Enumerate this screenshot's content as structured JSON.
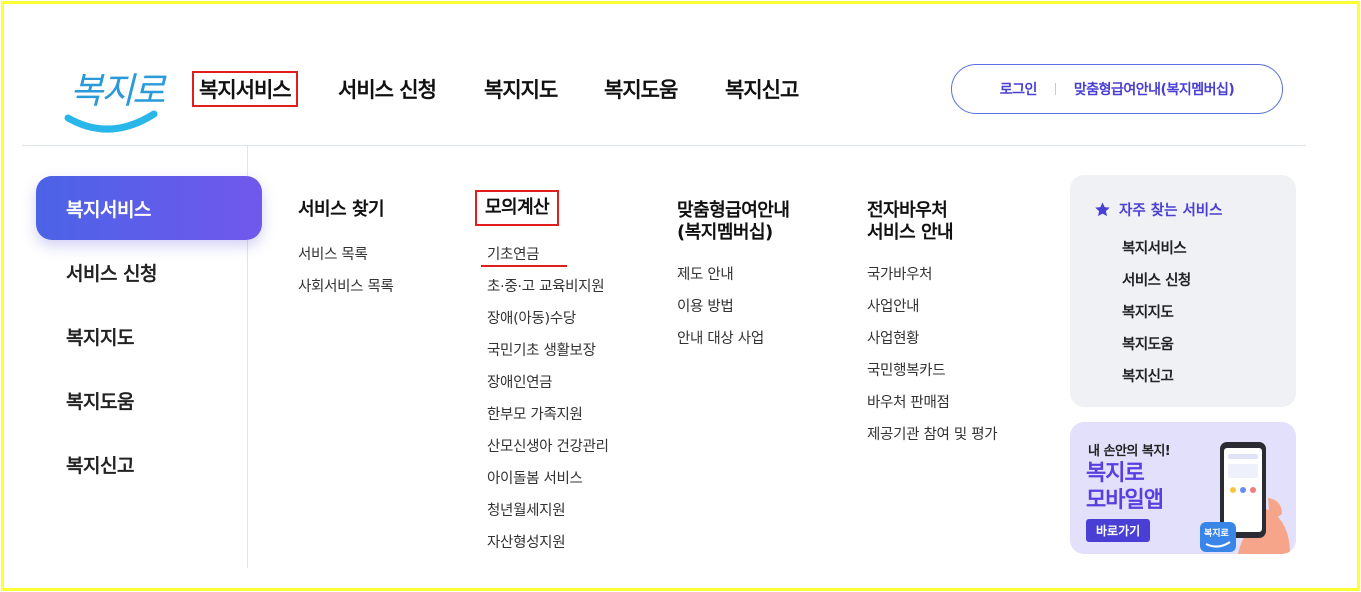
{
  "logo": {
    "text": "복지로"
  },
  "gnb": {
    "items": [
      "복지서비스",
      "서비스 신청",
      "복지지도",
      "복지도움",
      "복지신고"
    ]
  },
  "top_buttons": {
    "login": "로그인",
    "membership": "맞춤형급여안내(복지멤버십)"
  },
  "lnb": {
    "items": [
      "복지서비스",
      "서비스 신청",
      "복지지도",
      "복지도움",
      "복지신고"
    ]
  },
  "columns": [
    {
      "title": "서비스 찾기",
      "items": [
        "서비스 목록",
        "사회서비스 목록"
      ]
    },
    {
      "title": "모의계산",
      "items": [
        "기초연금",
        "초·중·고 교육비지원",
        "장애(아동)수당",
        "국민기초 생활보장",
        "장애인연금",
        "한부모 가족지원",
        "산모신생아 건강관리",
        "아이돌봄 서비스",
        "청년월세지원",
        "자산형성지원"
      ]
    },
    {
      "title": "맞춤형급여안내\n(복지멤버십)",
      "items": [
        "제도 안내",
        "이용 방법",
        "안내 대상 사업"
      ]
    },
    {
      "title": "전자바우처\n서비스 안내",
      "items": [
        "국가바우처",
        "사업안내",
        "사업현황",
        "국민행복카드",
        "바우처 판매점",
        "제공기관 참여 및 평가"
      ]
    }
  ],
  "favorites": {
    "title": "자주 찾는 서비스",
    "icon": "star-icon",
    "items": [
      "복지서비스",
      "서비스 신청",
      "복지지도",
      "복지도움",
      "복지신고"
    ]
  },
  "app_banner": {
    "small": "내 손안의 복지!",
    "big": "복지로\n모바일앱",
    "button": "바로가기",
    "badge_text": "복지로"
  },
  "colors": {
    "accent": "#4a3fd4",
    "highlight_red": "#e01e1e",
    "frame_yellow": "#ffff33",
    "logo_blue": "#2a9bd8"
  }
}
